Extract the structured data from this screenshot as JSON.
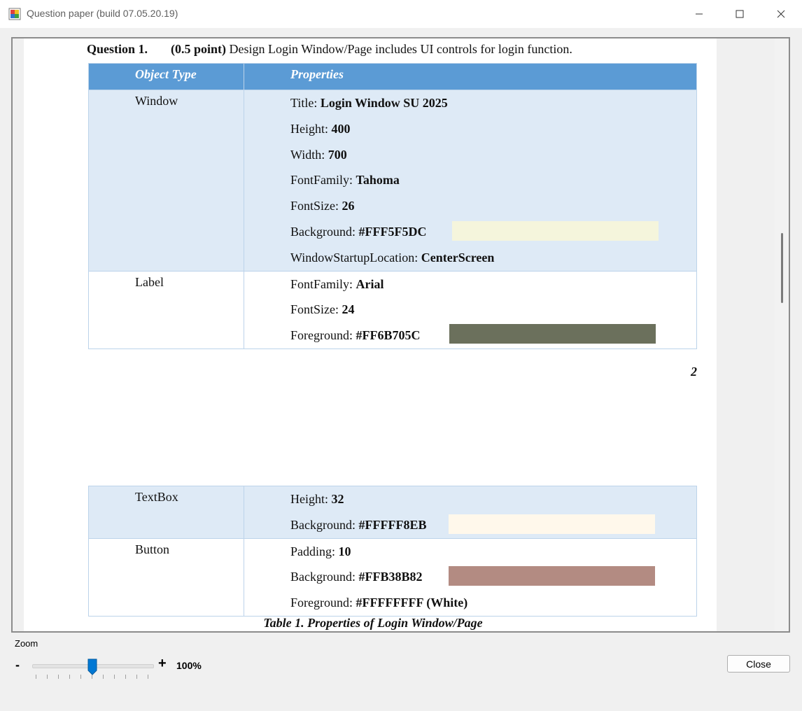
{
  "window": {
    "title": "Question paper (build 07.05.20.19)",
    "minimize": "—",
    "maximize": "☐",
    "close": "✕"
  },
  "document": {
    "question_label": "Question 1.",
    "question_points": "(0.5 point)",
    "question_text": "Design Login Window/Page includes UI controls for login function.",
    "table_headers": [
      "Object Type",
      "Properties"
    ],
    "page_number": "2",
    "caption": "Table 1. Properties of Login Window/Page",
    "table1_rows": [
      {
        "object": "Window",
        "props": [
          {
            "key": "Title: ",
            "value": "Login Window SU 2025"
          },
          {
            "key": "Height: ",
            "value": "400"
          },
          {
            "key": "Width: ",
            "value": "700"
          },
          {
            "key": "FontFamily: ",
            "value": "Tahoma"
          },
          {
            "key": "FontSize: ",
            "value": "26"
          },
          {
            "key": "Background: ",
            "value": "#FFF5F5DC"
          },
          {
            "key": "WindowStartupLocation: ",
            "value": "CenterScreen"
          }
        ]
      },
      {
        "object": "Label",
        "props": [
          {
            "key": "FontFamily: ",
            "value": "Arial"
          },
          {
            "key": "FontSize: ",
            "value": "24"
          },
          {
            "key": "Foreground: ",
            "value": "#FF6B705C"
          }
        ]
      }
    ],
    "table2_rows": [
      {
        "object": "TextBox",
        "props": [
          {
            "key": "Height: ",
            "value": "32"
          },
          {
            "key": "Background: ",
            "value": "#FFFFF8EB"
          }
        ]
      },
      {
        "object": "Button",
        "props": [
          {
            "key": "Padding: ",
            "value": "10"
          },
          {
            "key": "Background: ",
            "value": "#FFB38B82"
          },
          {
            "key": "Foreground: ",
            "value": "#FFFFFFFF (White)"
          }
        ]
      }
    ]
  },
  "zoom": {
    "label": "Zoom",
    "minus": "-",
    "plus": "+",
    "value_text": "100%",
    "level_fraction": 0.5
  },
  "close_button": "Close",
  "colors": {
    "header_blue": "#5b9bd5",
    "row_blue": "#deeaf6",
    "swatch_window_bg": "#f5f5dc",
    "swatch_label_fg": "#6b705c",
    "swatch_textbox_bg": "#fff8eb",
    "swatch_button_bg": "#b38b82",
    "slider_blue": "#0078d4"
  }
}
